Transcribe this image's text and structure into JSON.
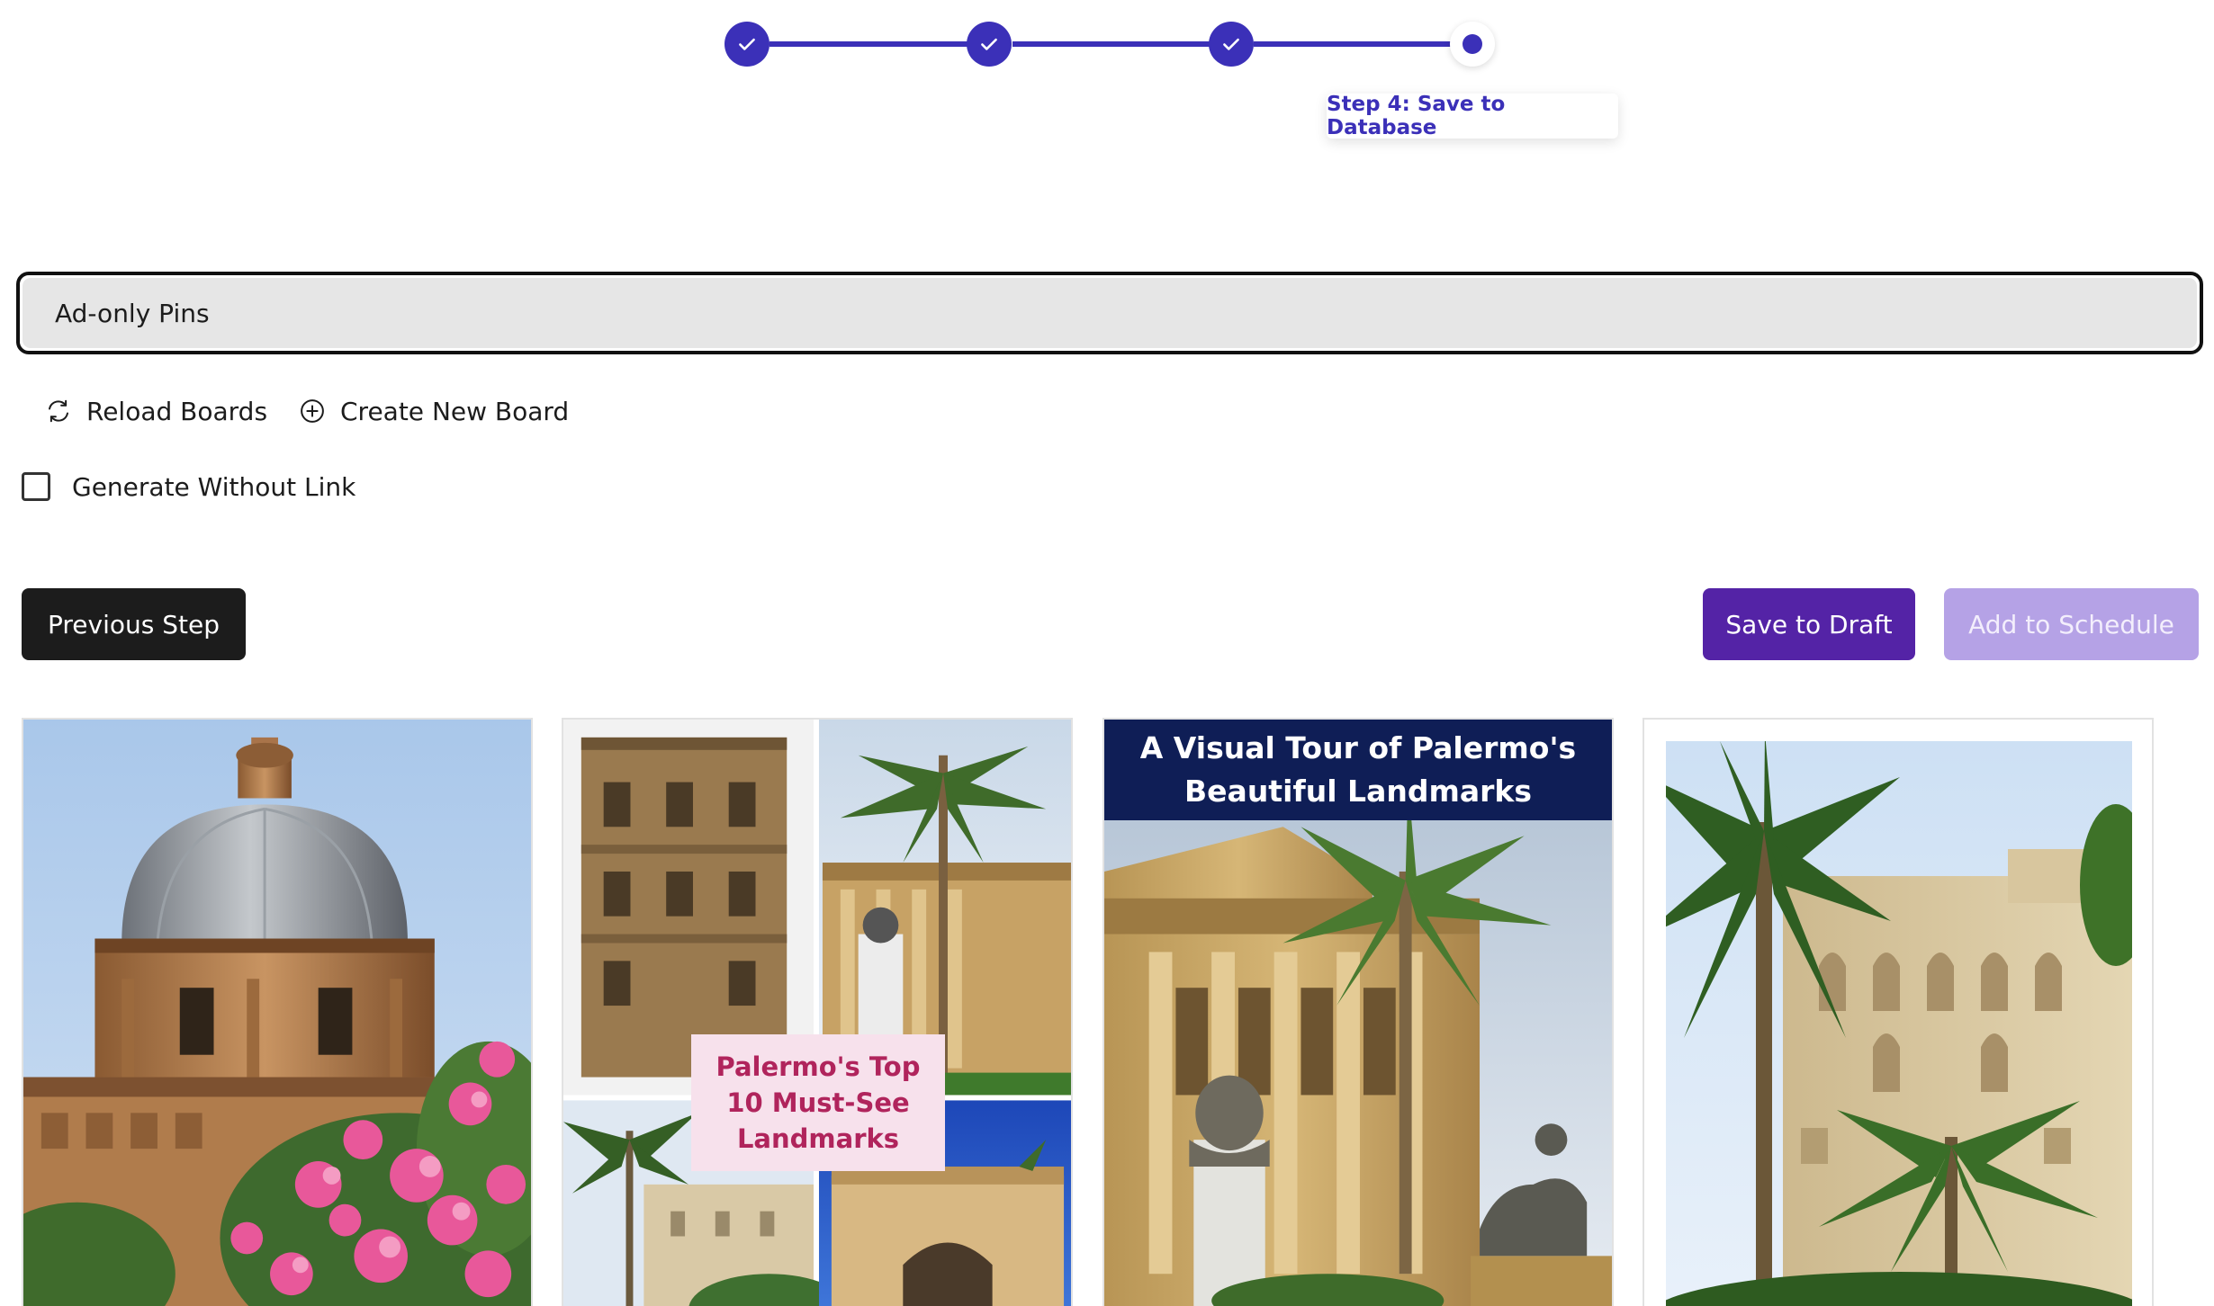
{
  "stepper": {
    "completed_steps": 3,
    "current_step": 4,
    "current_step_label": "Step 4: Save to Database"
  },
  "board": {
    "selected": "Ad-only Pins"
  },
  "actions": {
    "reload_boards": "Reload Boards",
    "create_new_board": "Create New Board",
    "generate_without_link": "Generate Without Link",
    "generate_without_link_checked": false
  },
  "buttons": {
    "previous_step": "Previous Step",
    "save_to_draft": "Save to Draft",
    "add_to_schedule": "Add to Schedule"
  },
  "pins": [
    {
      "text": ""
    },
    {
      "text": "Palermo's Top 10 Must-See Landmarks"
    },
    {
      "text": "A Visual Tour of Palermo's Beautiful Landmarks"
    },
    {
      "text": ""
    }
  ],
  "colors": {
    "accent": "#3b30b8",
    "primary_button": "#5423a6",
    "disabled_button": "#b5a2e6",
    "dark_button": "#1c1c1c"
  }
}
